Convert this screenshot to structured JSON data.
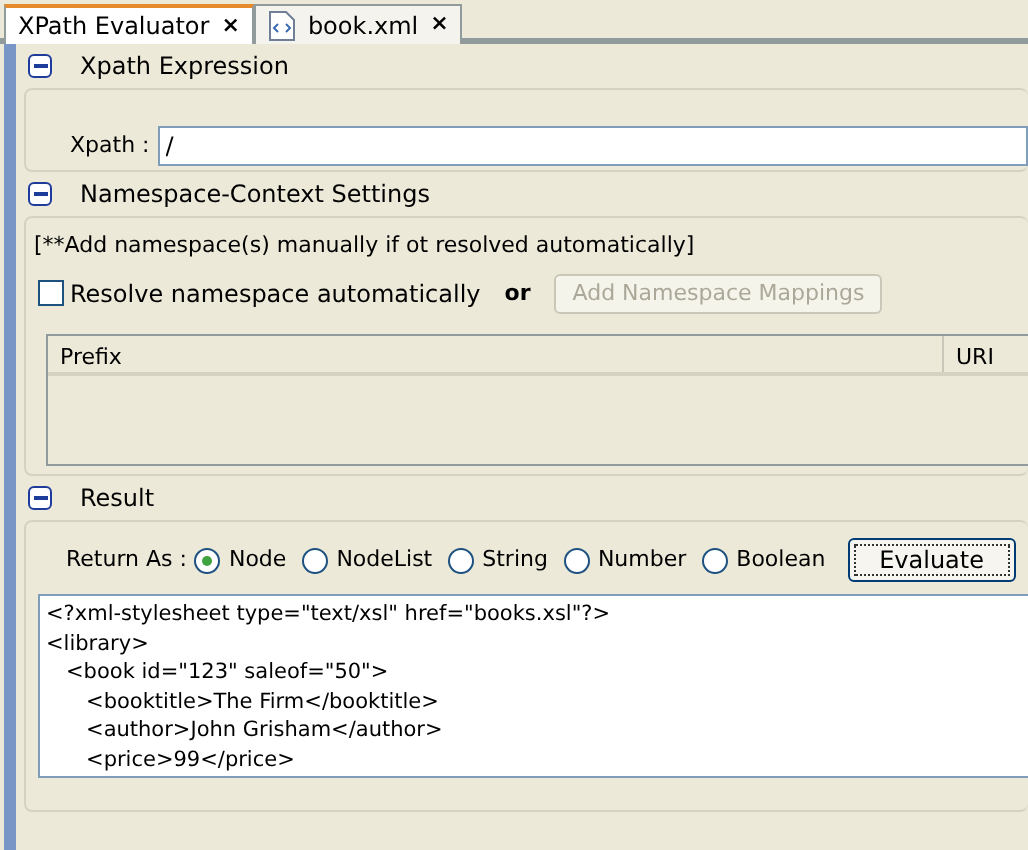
{
  "tabs": [
    {
      "label": "XPath Evaluator",
      "selected": true,
      "kind": "tool",
      "close": "×"
    },
    {
      "label": "book.xml",
      "selected": false,
      "kind": "file",
      "close": "×"
    }
  ],
  "xpath_section": {
    "title": "Xpath Expression",
    "expanded": true,
    "label": "Xpath :",
    "value": "/"
  },
  "namespace_section": {
    "title": "Namespace-Context Settings",
    "expanded": true,
    "note": "[**Add namespace(s) manually if ot resolved automatically]",
    "resolve_checkbox": {
      "label": "Resolve namespace automatically",
      "checked": false
    },
    "or_label": "or",
    "add_button": {
      "label": "Add Namespace Mappings",
      "disabled": true
    },
    "table": {
      "columns": [
        "Prefix",
        "URI"
      ]
    }
  },
  "result_section": {
    "title": "Result",
    "expanded": true,
    "return_label": "Return As :",
    "return_options": [
      {
        "label": "Node",
        "selected": true
      },
      {
        "label": "NodeList",
        "selected": false
      },
      {
        "label": "String",
        "selected": false
      },
      {
        "label": "Number",
        "selected": false
      },
      {
        "label": "Boolean",
        "selected": false
      }
    ],
    "evaluate_button": "Evaluate",
    "output_lines": [
      "<?xml-stylesheet type=\"text/xsl\" href=\"books.xsl\"?>",
      "<library>",
      "   <book id=\"123\" saleof=\"50\">",
      "      <booktitle>The Firm</booktitle>",
      "      <author>John Grisham</author>",
      "      <price>99</price>"
    ]
  }
}
